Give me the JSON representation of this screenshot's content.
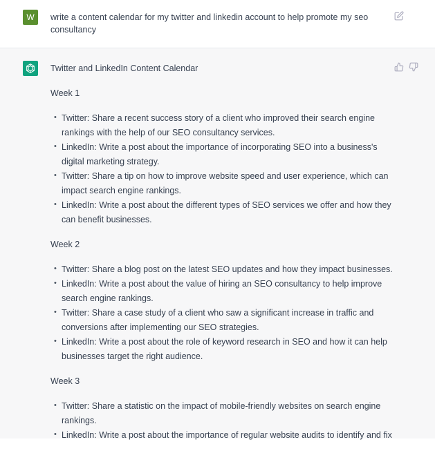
{
  "user": {
    "avatar_letter": "W",
    "message": "write a content calendar for my twitter and linkedin account to help promote my seo consultancy"
  },
  "assistant": {
    "title": "Twitter and LinkedIn Content Calendar",
    "weeks": [
      {
        "label": "Week 1",
        "items": [
          "Twitter: Share a recent success story of a client who improved their search engine rankings with the help of our SEO consultancy services.",
          "LinkedIn: Write a post about the importance of incorporating SEO into a business's digital marketing strategy.",
          "Twitter: Share a tip on how to improve website speed and user experience, which can impact search engine rankings.",
          "LinkedIn: Write a post about the different types of SEO services we offer and how they can benefit businesses."
        ]
      },
      {
        "label": "Week 2",
        "items": [
          "Twitter: Share a blog post on the latest SEO updates and how they impact businesses.",
          "LinkedIn: Write a post about the value of hiring an SEO consultancy to help improve search engine rankings.",
          "Twitter: Share a case study of a client who saw a significant increase in traffic and conversions after implementing our SEO strategies.",
          "LinkedIn: Write a post about the role of keyword research in SEO and how it can help businesses target the right audience."
        ]
      },
      {
        "label": "Week 3",
        "items": [
          "Twitter: Share a statistic on the impact of mobile-friendly websites on search engine rankings.",
          "LinkedIn: Write a post about the importance of regular website audits to identify and fix"
        ]
      }
    ]
  },
  "icons": {
    "edit": "edit-icon",
    "thumbs_up": "thumbs-up-icon",
    "thumbs_down": "thumbs-down-icon",
    "assistant_logo": "openai-logo-icon"
  },
  "colors": {
    "user_avatar": "#5a8f2e",
    "assistant_avatar": "#10a37f",
    "assistant_bg": "#f7f7f8"
  }
}
